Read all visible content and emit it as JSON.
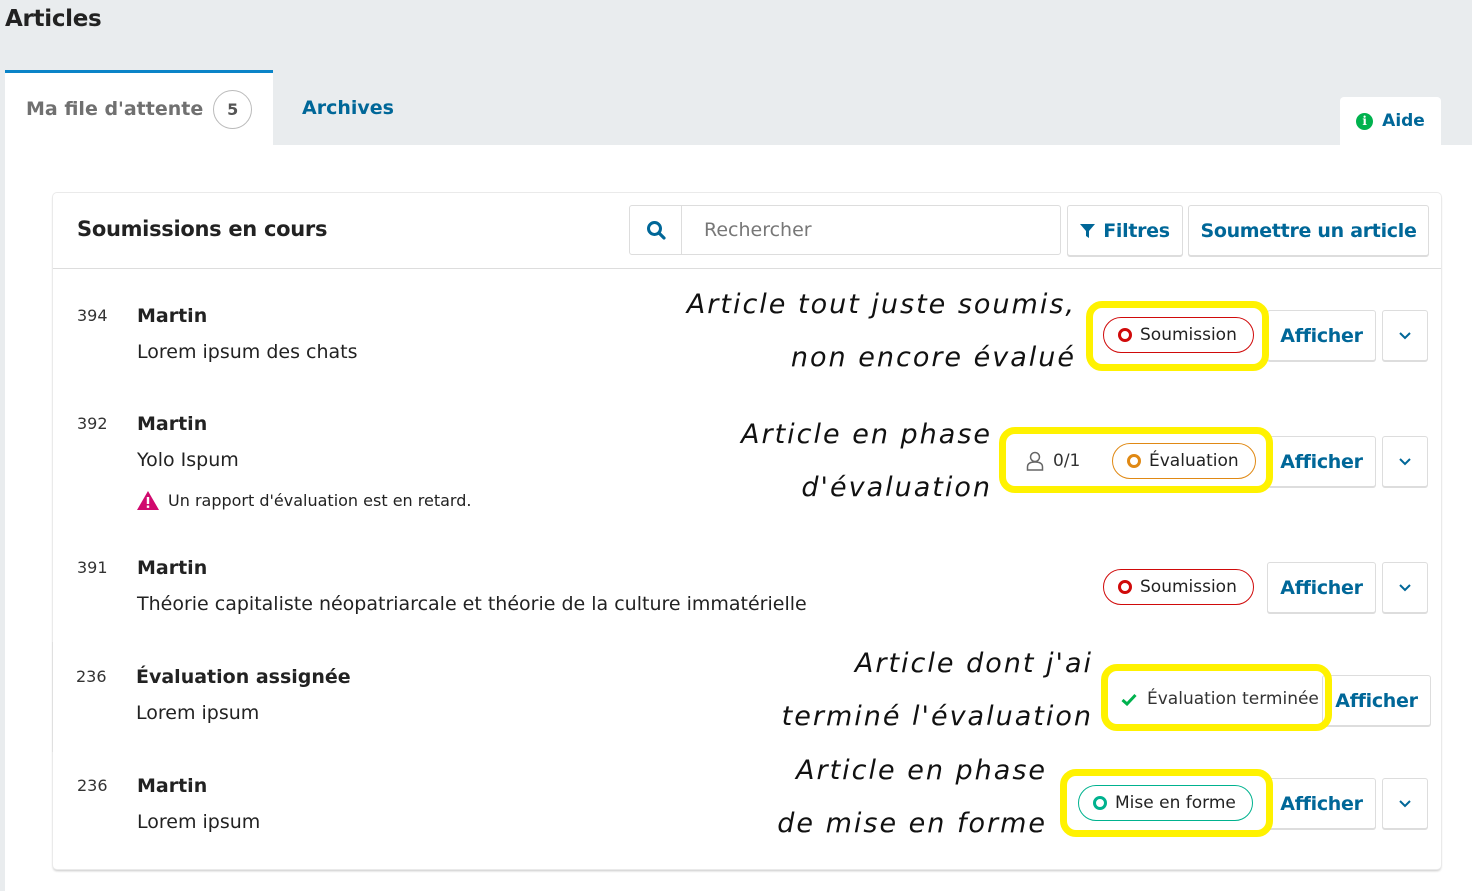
{
  "page": {
    "title": "Articles"
  },
  "tabs": [
    {
      "label": "Ma file d'attente",
      "count": "5",
      "active": true
    },
    {
      "label": "Archives",
      "active": false
    }
  ],
  "help": {
    "label": "Aide",
    "icon": "info-icon"
  },
  "panel": {
    "title": "Soumissions en cours",
    "search": {
      "placeholder": "Rechercher",
      "value": ""
    },
    "filter_label": "Filtres",
    "submit_label": "Soumettre un article"
  },
  "rows": [
    {
      "id": "394",
      "author": "Martin",
      "title": "Lorem ipsum des chats",
      "stage": "Soumission",
      "stage_color": "#d00a0a",
      "action": "Afficher"
    },
    {
      "id": "392",
      "author": "Martin",
      "title": "Yolo Ispum",
      "warning": "Un rapport d'évaluation est en retard.",
      "reviewers": "0/1",
      "stage": "Évaluation",
      "stage_color": "#e08914",
      "action": "Afficher"
    },
    {
      "id": "391",
      "author": "Martin",
      "title": "Théorie capitaliste néopatriarcale et théorie de la culture immatérielle",
      "stage": "Soumission",
      "stage_color": "#d00a0a",
      "action": "Afficher"
    },
    {
      "id": "236",
      "author": "Évaluation assignée",
      "title": "Lorem ipsum",
      "status": "Évaluation terminée",
      "action": "Afficher"
    },
    {
      "id": "236",
      "author": "Martin",
      "title": "Lorem ipsum",
      "stage": "Mise en forme",
      "stage_color": "#00b28f",
      "action": "Afficher"
    }
  ],
  "annotations": [
    {
      "line1": "Article tout juste soumis,",
      "line2": "non encore évalué"
    },
    {
      "line1": "Article en phase",
      "line2": "d'évaluation"
    },
    {
      "line1": "Article dont j'ai",
      "line2": "terminé l'évaluation"
    },
    {
      "line1": "Article en phase",
      "line2": "de mise en forme"
    }
  ],
  "colors": {
    "accent": "#006798",
    "tab_active_border": "#0a84c8",
    "warning": "#d00a6e",
    "check": "#00b24e",
    "highlight": "#fff200"
  }
}
